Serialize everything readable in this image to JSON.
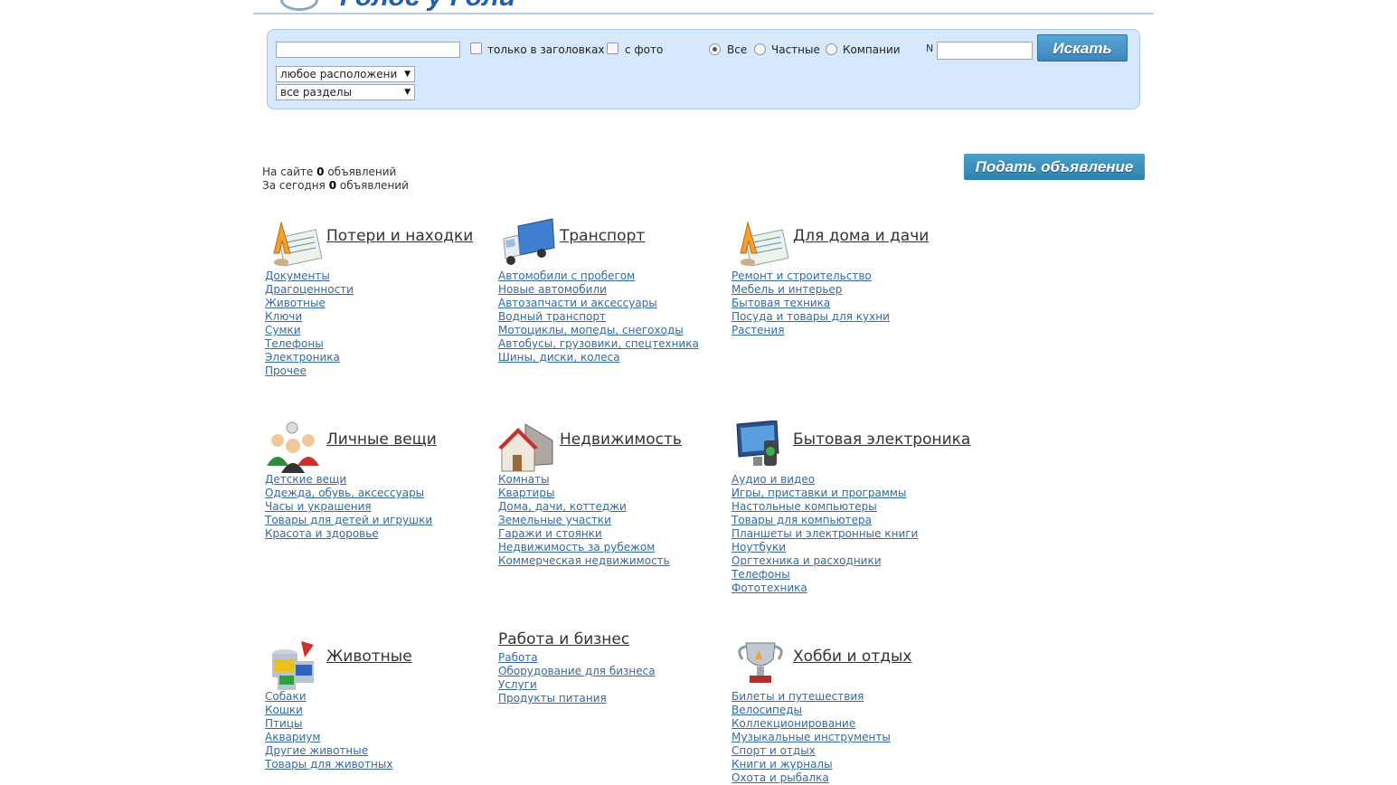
{
  "header": {
    "logo_text": "Голос у Голи"
  },
  "search": {
    "query_value": "",
    "only_titles_label": "только в заголовках",
    "with_photo_label": "с фото",
    "radio_all": "Все",
    "radio_private": "Частные",
    "radio_companies": "Компании",
    "n_label": "N",
    "n_value": "",
    "submit_label": "Искать",
    "location_select": "любое расположени",
    "section_select": "все разделы"
  },
  "stats": {
    "total_prefix": "На сайте",
    "total_count": "0",
    "total_suffix": "объявлений",
    "today_prefix": "За сегодня",
    "today_count": "0",
    "today_suffix": "объявлений"
  },
  "post_ad_label": "Подать объявление",
  "categories": [
    {
      "title": "Потери и находки",
      "icon": "lost-found-icon",
      "links": [
        "Документы",
        "Драгоценности",
        "Животные",
        "Ключи",
        "Сумки",
        "Телефоны",
        "Электроника",
        "Прочее"
      ]
    },
    {
      "title": "Транспорт",
      "icon": "truck-icon",
      "links": [
        "Автомобили с пробегом",
        "Новые автомобили",
        "Автозапчасти и аксессуары",
        "Водный транспорт",
        "Мотоциклы, мопеды, снегоходы",
        "Автобусы, грузовики, спецтехника",
        "Шины, диски, колеса"
      ]
    },
    {
      "title": "Для дома и дачи",
      "icon": "home-garden-icon",
      "links": [
        "Ремонт и строительство",
        "Мебель и интерьер",
        "Бытовая техника",
        "Посуда и товары для кухни",
        "Растения"
      ]
    },
    {
      "title": "Личные вещи",
      "icon": "people-icon",
      "links": [
        "Детские вещи",
        "Одежда, обувь, аксессуары",
        "Часы и украшения",
        "Товары для детей и игрушки",
        "Красота и здоровье"
      ]
    },
    {
      "title": "Недвижимость",
      "icon": "houses-icon",
      "links": [
        "Комнаты",
        "Квартиры",
        "Дома, дачи, коттеджи",
        "Земельные участки",
        "Гаражи и стоянки",
        "Недвижимость за рубежом",
        "Коммерческая недвижимость"
      ]
    },
    {
      "title": "Бытовая электроника",
      "icon": "monitor-phone-icon",
      "links": [
        "Аудио и видео",
        "Игры, приставки и программы",
        "Настольные компьютеры",
        "Товары для компьютера",
        "Планшеты и электронные книги",
        "Ноутбуки",
        "Оргтехника и расходники",
        "Телефоны",
        "Фототехника"
      ]
    },
    {
      "title": "Животные",
      "icon": "paint-cans-icon",
      "links": [
        "Собаки",
        "Кошки",
        "Птицы",
        "Аквариум",
        "Другие животные",
        "Товары для животных"
      ]
    },
    {
      "title": "Работа и бизнес",
      "icon": "",
      "links": [
        "Работа",
        "Оборудование для бизнеса",
        "Услуги",
        "Продукты питания"
      ]
    },
    {
      "title": "Хобби и отдых",
      "icon": "trophy-icon",
      "links": [
        "Билеты и путешествия",
        "Велосипеды",
        "Коллекционирование",
        "Музыкальные инструменты",
        "Спорт и отдых",
        "Книги и журналы",
        "Охота и рыбалка"
      ]
    }
  ]
}
